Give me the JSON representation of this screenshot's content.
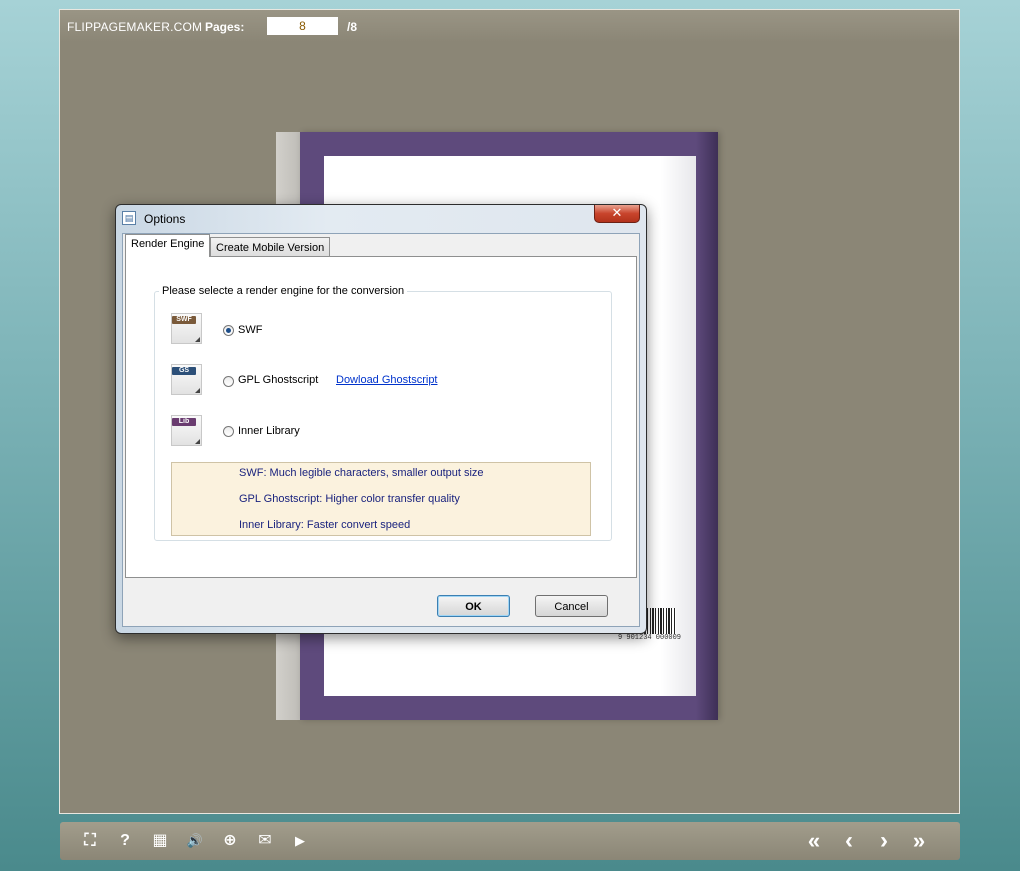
{
  "viewer": {
    "brand": "FLIPPAGEMAKER.COM",
    "pages_label": "Pages:",
    "current_page": "8",
    "total_pages": "/8"
  },
  "book": {
    "barcode_number": "9 901234 000009"
  },
  "dialog": {
    "title": "Options",
    "close_glyph": "✕",
    "tabs": [
      "Render Engine",
      "Create Mobile Version"
    ],
    "group_label": "Please selecte a render engine for the conversion",
    "engines": [
      {
        "tag": "SWF",
        "tag_color": "#7a5a3a",
        "label": "SWF",
        "selected": true
      },
      {
        "tag": "GS",
        "tag_color": "#2c4f78",
        "label": "GPL Ghostscript",
        "selected": false,
        "link": "Dowload Ghostscript"
      },
      {
        "tag": "Lib",
        "tag_color": "#6a3c70",
        "label": "Inner Library",
        "selected": false
      }
    ],
    "info_lines": [
      "SWF: Much legible characters, smaller output size",
      "GPL Ghostscript: Higher color transfer quality",
      "Inner Library: Faster convert speed"
    ],
    "ok_label": "OK",
    "cancel_label": "Cancel"
  },
  "toolbar": {
    "left_icons": [
      {
        "name": "fullscreen-icon",
        "glyph": "⛶"
      },
      {
        "name": "help-icon",
        "glyph": "?"
      },
      {
        "name": "thumbnails-icon",
        "glyph": "▦"
      },
      {
        "name": "sound-icon",
        "glyph": "🔊"
      },
      {
        "name": "zoom-in-icon",
        "glyph": "⊕"
      },
      {
        "name": "email-icon",
        "glyph": "✉"
      },
      {
        "name": "autoplay-icon",
        "glyph": "▶"
      }
    ],
    "right_icons": [
      {
        "name": "first-page-icon",
        "glyph": "«"
      },
      {
        "name": "previous-page-icon",
        "glyph": "‹"
      },
      {
        "name": "next-page-icon",
        "glyph": "›"
      },
      {
        "name": "last-page-icon",
        "glyph": "»"
      }
    ]
  }
}
